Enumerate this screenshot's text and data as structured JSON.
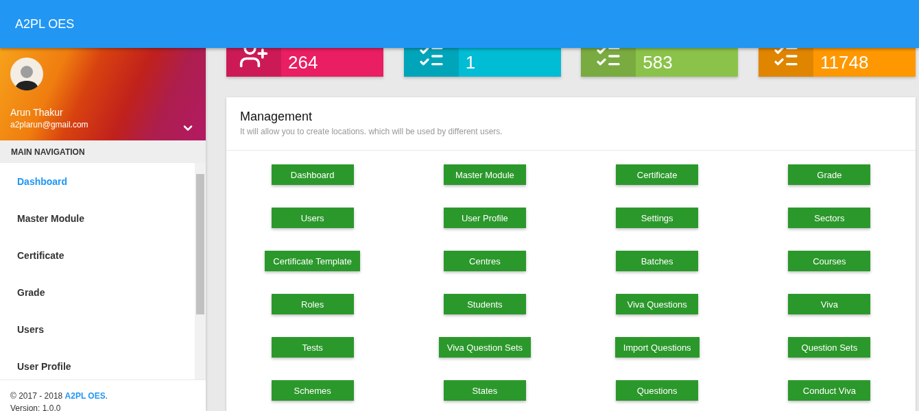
{
  "header": {
    "title": "A2PL OES"
  },
  "user": {
    "name": "Arun Thakur",
    "email": "a2plarun@gmail.com"
  },
  "navigation": {
    "heading": "MAIN NAVIGATION",
    "items": [
      {
        "label": "Dashboard",
        "selected": true
      },
      {
        "label": "Master Module",
        "selected": false
      },
      {
        "label": "Certificate",
        "selected": false
      },
      {
        "label": "Grade",
        "selected": false
      },
      {
        "label": "Users",
        "selected": false
      },
      {
        "label": "User Profile",
        "selected": false
      }
    ]
  },
  "footer": {
    "copyright": "© 2017 - 2018 ",
    "brand": "A2PL OES",
    "suffix": ".",
    "version": "Version: 1.0.0"
  },
  "info_boxes": [
    {
      "kind": "person",
      "value": "264",
      "color": "#e91e63"
    },
    {
      "kind": "list",
      "value": "1",
      "color": "#00bcd4"
    },
    {
      "kind": "list",
      "value": "583",
      "color": "#8bc34a"
    },
    {
      "kind": "list",
      "value": "11748",
      "color": "#ff9800"
    }
  ],
  "management": {
    "title": "Management",
    "subtitle": "It will allow you to create locations. which will be used by different users.",
    "buttons": [
      "Dashboard",
      "Master Module",
      "Certificate",
      "Grade",
      "Users",
      "User Profile",
      "Settings",
      "Sectors",
      "Certificate Template",
      "Centres",
      "Batches",
      "Courses",
      "Roles",
      "Students",
      "Viva Questions",
      "Viva",
      "Tests",
      "Viva Question Sets",
      "Import Questions",
      "Question Sets",
      "Schemes",
      "States",
      "Questions",
      "Conduct Viva"
    ]
  }
}
